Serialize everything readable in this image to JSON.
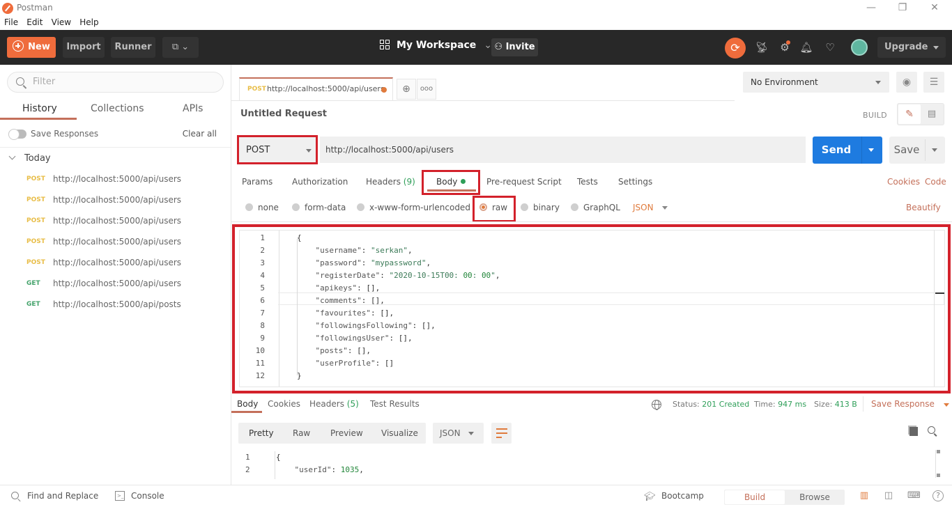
{
  "window": {
    "title": "Postman",
    "controls": {
      "minimize": "—",
      "restore": "❐",
      "close": "✕"
    }
  },
  "menubar": [
    "File",
    "Edit",
    "View",
    "Help"
  ],
  "header": {
    "new_label": "New",
    "import_label": "Import",
    "runner_label": "Runner",
    "workspace_label": "My Workspace",
    "invite_label": "Invite",
    "upgrade_label": "Upgrade",
    "icons": [
      "sync-icon",
      "satellite-icon",
      "settings-icon",
      "bell-icon",
      "heart-icon",
      "avatar"
    ],
    "accent_color": "#ef6c3c"
  },
  "sidebar": {
    "filter_placeholder": "Filter",
    "tabs": [
      "History",
      "Collections",
      "APIs"
    ],
    "active_tab": "History",
    "save_responses_label": "Save Responses",
    "save_responses_on": false,
    "clear_all_label": "Clear all",
    "group_label": "Today",
    "history": [
      {
        "method": "POST",
        "url": "http://localhost:5000/api/users"
      },
      {
        "method": "POST",
        "url": "http://localhost:5000/api/users"
      },
      {
        "method": "POST",
        "url": "http://localhost:5000/api/users"
      },
      {
        "method": "POST",
        "url": "http://localhost:5000/api/users"
      },
      {
        "method": "POST",
        "url": "http://localhost:5000/api/users"
      },
      {
        "method": "GET",
        "url": "http://localhost:5000/api/users"
      },
      {
        "method": "GET",
        "url": "http://localhost:5000/api/posts"
      }
    ]
  },
  "request_tab": {
    "method": "POST",
    "url": "http://localhost:5000/api/users",
    "unsaved": true
  },
  "environment": {
    "selected": "No Environment"
  },
  "request": {
    "title": "Untitled Request",
    "mode_label": "BUILD",
    "method": "POST",
    "url": "http://localhost:5000/api/users",
    "send_label": "Send",
    "save_label": "Save",
    "tabs": [
      {
        "label": "Params"
      },
      {
        "label": "Authorization"
      },
      {
        "label": "Headers",
        "count": "(9)"
      },
      {
        "label": "Body"
      },
      {
        "label": "Pre-request Script"
      },
      {
        "label": "Tests"
      },
      {
        "label": "Settings"
      }
    ],
    "active_tab": "Body",
    "cookies_label": "Cookies",
    "code_label": "Code",
    "body_types": [
      "none",
      "form-data",
      "x-www-form-urlencoded",
      "raw",
      "binary",
      "GraphQL"
    ],
    "selected_body_type": "raw",
    "raw_format": "JSON",
    "beautify_label": "Beautify",
    "body_lines": [
      "{",
      "    \"username\": \"serkan\",",
      "    \"password\": \"mypassword\",",
      "    \"registerDate\": \"2020-10-15T00:00:00\",",
      "    \"apikeys\": [],",
      "    \"comments\": [],",
      "    \"favourites\": [],",
      "    \"followingsFollowing\": [],",
      "    \"followingsUser\": [],",
      "    \"posts\": [],",
      "    \"userProfile\": []",
      "}"
    ]
  },
  "response": {
    "tabs": [
      {
        "label": "Body"
      },
      {
        "label": "Cookies"
      },
      {
        "label": "Headers",
        "count": "(5)"
      },
      {
        "label": "Test Results"
      }
    ],
    "active_tab": "Body",
    "status_label": "Status:",
    "status_value": "201 Created",
    "time_label": "Time:",
    "time_value": "947 ms",
    "size_label": "Size:",
    "size_value": "413 B",
    "save_response_label": "Save Response",
    "view_tabs": [
      "Pretty",
      "Raw",
      "Preview",
      "Visualize"
    ],
    "active_view": "Pretty",
    "format": "JSON",
    "body_lines": [
      "{",
      "    \"userId\": 1035,"
    ]
  },
  "footer": {
    "find_replace_label": "Find and Replace",
    "console_label": "Console",
    "bootcamp_label": "Bootcamp",
    "build_label": "Build",
    "browse_label": "Browse",
    "active_mode": "Build"
  }
}
